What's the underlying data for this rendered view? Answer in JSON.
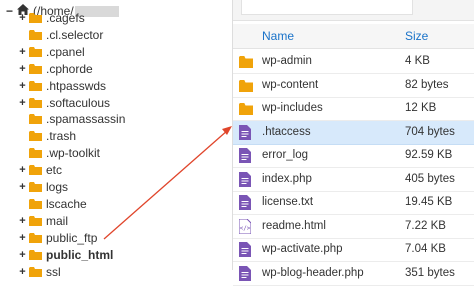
{
  "tree": {
    "root_prefix": "(/home/",
    "root_suffix": "",
    "items": [
      {
        "label": ".cagefs",
        "toggle": "+"
      },
      {
        "label": ".cl.selector",
        "toggle": ""
      },
      {
        "label": ".cpanel",
        "toggle": "+"
      },
      {
        "label": ".cphorde",
        "toggle": "+"
      },
      {
        "label": ".htpasswds",
        "toggle": "+"
      },
      {
        "label": ".softaculous",
        "toggle": "+"
      },
      {
        "label": ".spamassassin",
        "toggle": ""
      },
      {
        "label": ".trash",
        "toggle": ""
      },
      {
        "label": ".wp-toolkit",
        "toggle": ""
      },
      {
        "label": "etc",
        "toggle": "+"
      },
      {
        "label": "logs",
        "toggle": "+"
      },
      {
        "label": "lscache",
        "toggle": ""
      },
      {
        "label": "mail",
        "toggle": "+"
      },
      {
        "label": "public_ftp",
        "toggle": "+"
      },
      {
        "label": "public_html",
        "toggle": "+"
      },
      {
        "label": "ssl",
        "toggle": "+"
      }
    ]
  },
  "table": {
    "col_name": "Name",
    "col_size": "Size",
    "rows": [
      {
        "name": "wp-admin",
        "size": "4 KB",
        "type": "folder"
      },
      {
        "name": "wp-content",
        "size": "82 bytes",
        "type": "folder"
      },
      {
        "name": "wp-includes",
        "size": "12 KB",
        "type": "folder"
      },
      {
        "name": ".htaccess",
        "size": "704 bytes",
        "type": "text"
      },
      {
        "name": "error_log",
        "size": "92.59 KB",
        "type": "text"
      },
      {
        "name": "index.php",
        "size": "405 bytes",
        "type": "text"
      },
      {
        "name": "license.txt",
        "size": "19.45 KB",
        "type": "text"
      },
      {
        "name": "readme.html",
        "size": "7.22 KB",
        "type": "html"
      },
      {
        "name": "wp-activate.php",
        "size": "7.04 KB",
        "type": "text"
      },
      {
        "name": "wp-blog-header.php",
        "size": "351 bytes",
        "type": "text"
      }
    ]
  },
  "colors": {
    "folder": "#f0a30a",
    "file_icon": "#7a55b5",
    "link": "#1a73c9",
    "selected_row": "#d7e9fb",
    "arrow": "#e0452b"
  },
  "icons": {
    "home": "home-icon",
    "folder": "folder-icon",
    "text_file": "file-text-icon",
    "html_file": "file-code-icon"
  }
}
